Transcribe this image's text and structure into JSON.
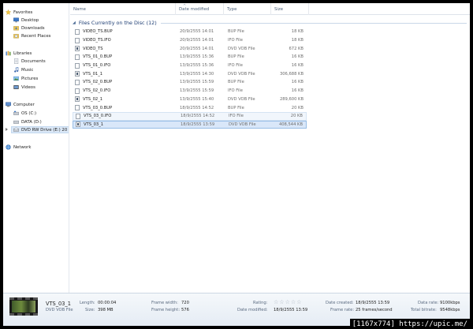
{
  "nav": {
    "favorites": "Favorites",
    "desktop": "Desktop",
    "downloads": "Downloads",
    "recent_places": "Recent Places",
    "libraries": "Libraries",
    "documents": "Documents",
    "music": "Music",
    "pictures": "Pictures",
    "videos": "Videos",
    "computer": "Computer",
    "os_c": "OS (C:)",
    "data_d": "DATA (D:)",
    "dvd_drive": "DVD RW Drive (E:) 20",
    "network": "Network"
  },
  "columns": {
    "name": "Name",
    "date_modified": "Date modified",
    "type": "Type",
    "size": "Size"
  },
  "group": {
    "title": "Files Currently on the Disc (12)"
  },
  "files": [
    {
      "name": "VIDEO_TS.BUP",
      "date": "20/9/2555 14:01",
      "type": "BUP File",
      "size": "18 KB",
      "icon": "file-icon"
    },
    {
      "name": "VIDEO_TS.IFO",
      "date": "20/9/2555 14:01",
      "type": "IFO File",
      "size": "18 KB",
      "icon": "file-icon"
    },
    {
      "name": "VIDEO_TS",
      "date": "20/9/2555 14:01",
      "type": "DVD VOB File",
      "size": "672 KB",
      "icon": "dvd-file-icon"
    },
    {
      "name": "VTS_01_0.BUP",
      "date": "13/9/2555 15:36",
      "type": "BUP File",
      "size": "16 KB",
      "icon": "file-icon"
    },
    {
      "name": "VTS_01_0.IFO",
      "date": "13/9/2555 15:36",
      "type": "IFO File",
      "size": "16 KB",
      "icon": "file-icon"
    },
    {
      "name": "VTS_01_1",
      "date": "13/9/2555 14:30",
      "type": "DVD VOB File",
      "size": "306,688 KB",
      "icon": "dvd-file-icon"
    },
    {
      "name": "VTS_02_0.BUP",
      "date": "13/9/2555 15:59",
      "type": "BUP File",
      "size": "16 KB",
      "icon": "file-icon"
    },
    {
      "name": "VTS_02_0.IFO",
      "date": "13/9/2555 15:59",
      "type": "IFO File",
      "size": "16 KB",
      "icon": "file-icon"
    },
    {
      "name": "VTS_02_1",
      "date": "13/9/2555 15:40",
      "type": "DVD VOB File",
      "size": "289,600 KB",
      "icon": "dvd-file-icon"
    },
    {
      "name": "VTS_03_0.BUP",
      "date": "18/9/2555 14:52",
      "type": "BUP File",
      "size": "20 KB",
      "icon": "file-icon"
    },
    {
      "name": "VTS_03_0.IFO",
      "date": "18/9/2555 14:52",
      "type": "IFO File",
      "size": "20 KB",
      "icon": "file-icon"
    },
    {
      "name": "VTS_03_1",
      "date": "18/9/2555 13:59",
      "type": "DVD VOB File",
      "size": "408,544 KB",
      "icon": "dvd-file-icon"
    }
  ],
  "details": {
    "name": "VTS_03_1",
    "type": "DVD VOB File",
    "length_label": "Length:",
    "length": "00:00:04",
    "size_label": "Size:",
    "size": "398 MB",
    "frame_width_label": "Frame width:",
    "frame_width": "720",
    "frame_height_label": "Frame height:",
    "frame_height": "576",
    "rating_label": "Rating:",
    "date_modified_label": "Date modified:",
    "date_modified": "18/9/2555 13:59",
    "date_created_label": "Date created:",
    "date_created": "18/9/2555 13:59",
    "frame_rate_label": "Frame rate:",
    "frame_rate": "25 frames/second",
    "data_rate_label": "Data rate:",
    "data_rate": "9100kbps",
    "total_bitrate_label": "Total bitrate:",
    "total_bitrate": "9548kbps"
  },
  "watermark": "[1167x774] https://upic.me/",
  "colors": {
    "accent": "#1e3e74",
    "selection": "#d9e7f9",
    "selection_border": "#97bde6"
  }
}
